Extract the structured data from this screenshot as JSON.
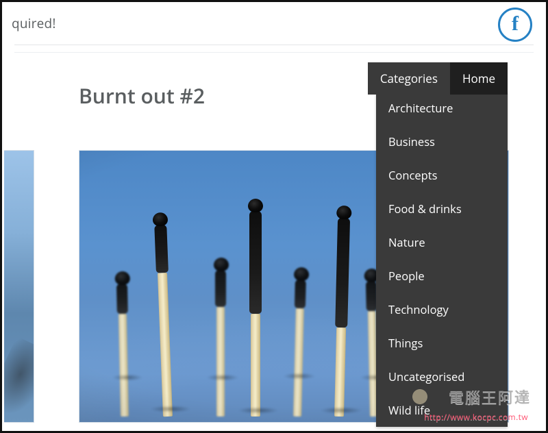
{
  "header": {
    "partial_text": "quired!",
    "social": {
      "facebook": "f"
    }
  },
  "page": {
    "title": "Burnt out #2"
  },
  "nav": {
    "tabs": [
      {
        "label": "Categories"
      },
      {
        "label": "Home"
      }
    ],
    "dropdown": [
      {
        "label": "Architecture"
      },
      {
        "label": "Business"
      },
      {
        "label": "Concepts"
      },
      {
        "label": "Food & drinks"
      },
      {
        "label": "Nature"
      },
      {
        "label": "People"
      },
      {
        "label": "Technology"
      },
      {
        "label": "Things"
      },
      {
        "label": "Uncategorised"
      },
      {
        "label": "Wild life"
      }
    ]
  },
  "watermark": {
    "text_cn": "電腦王阿達",
    "url": "http://www.kocpc.com.tw"
  }
}
